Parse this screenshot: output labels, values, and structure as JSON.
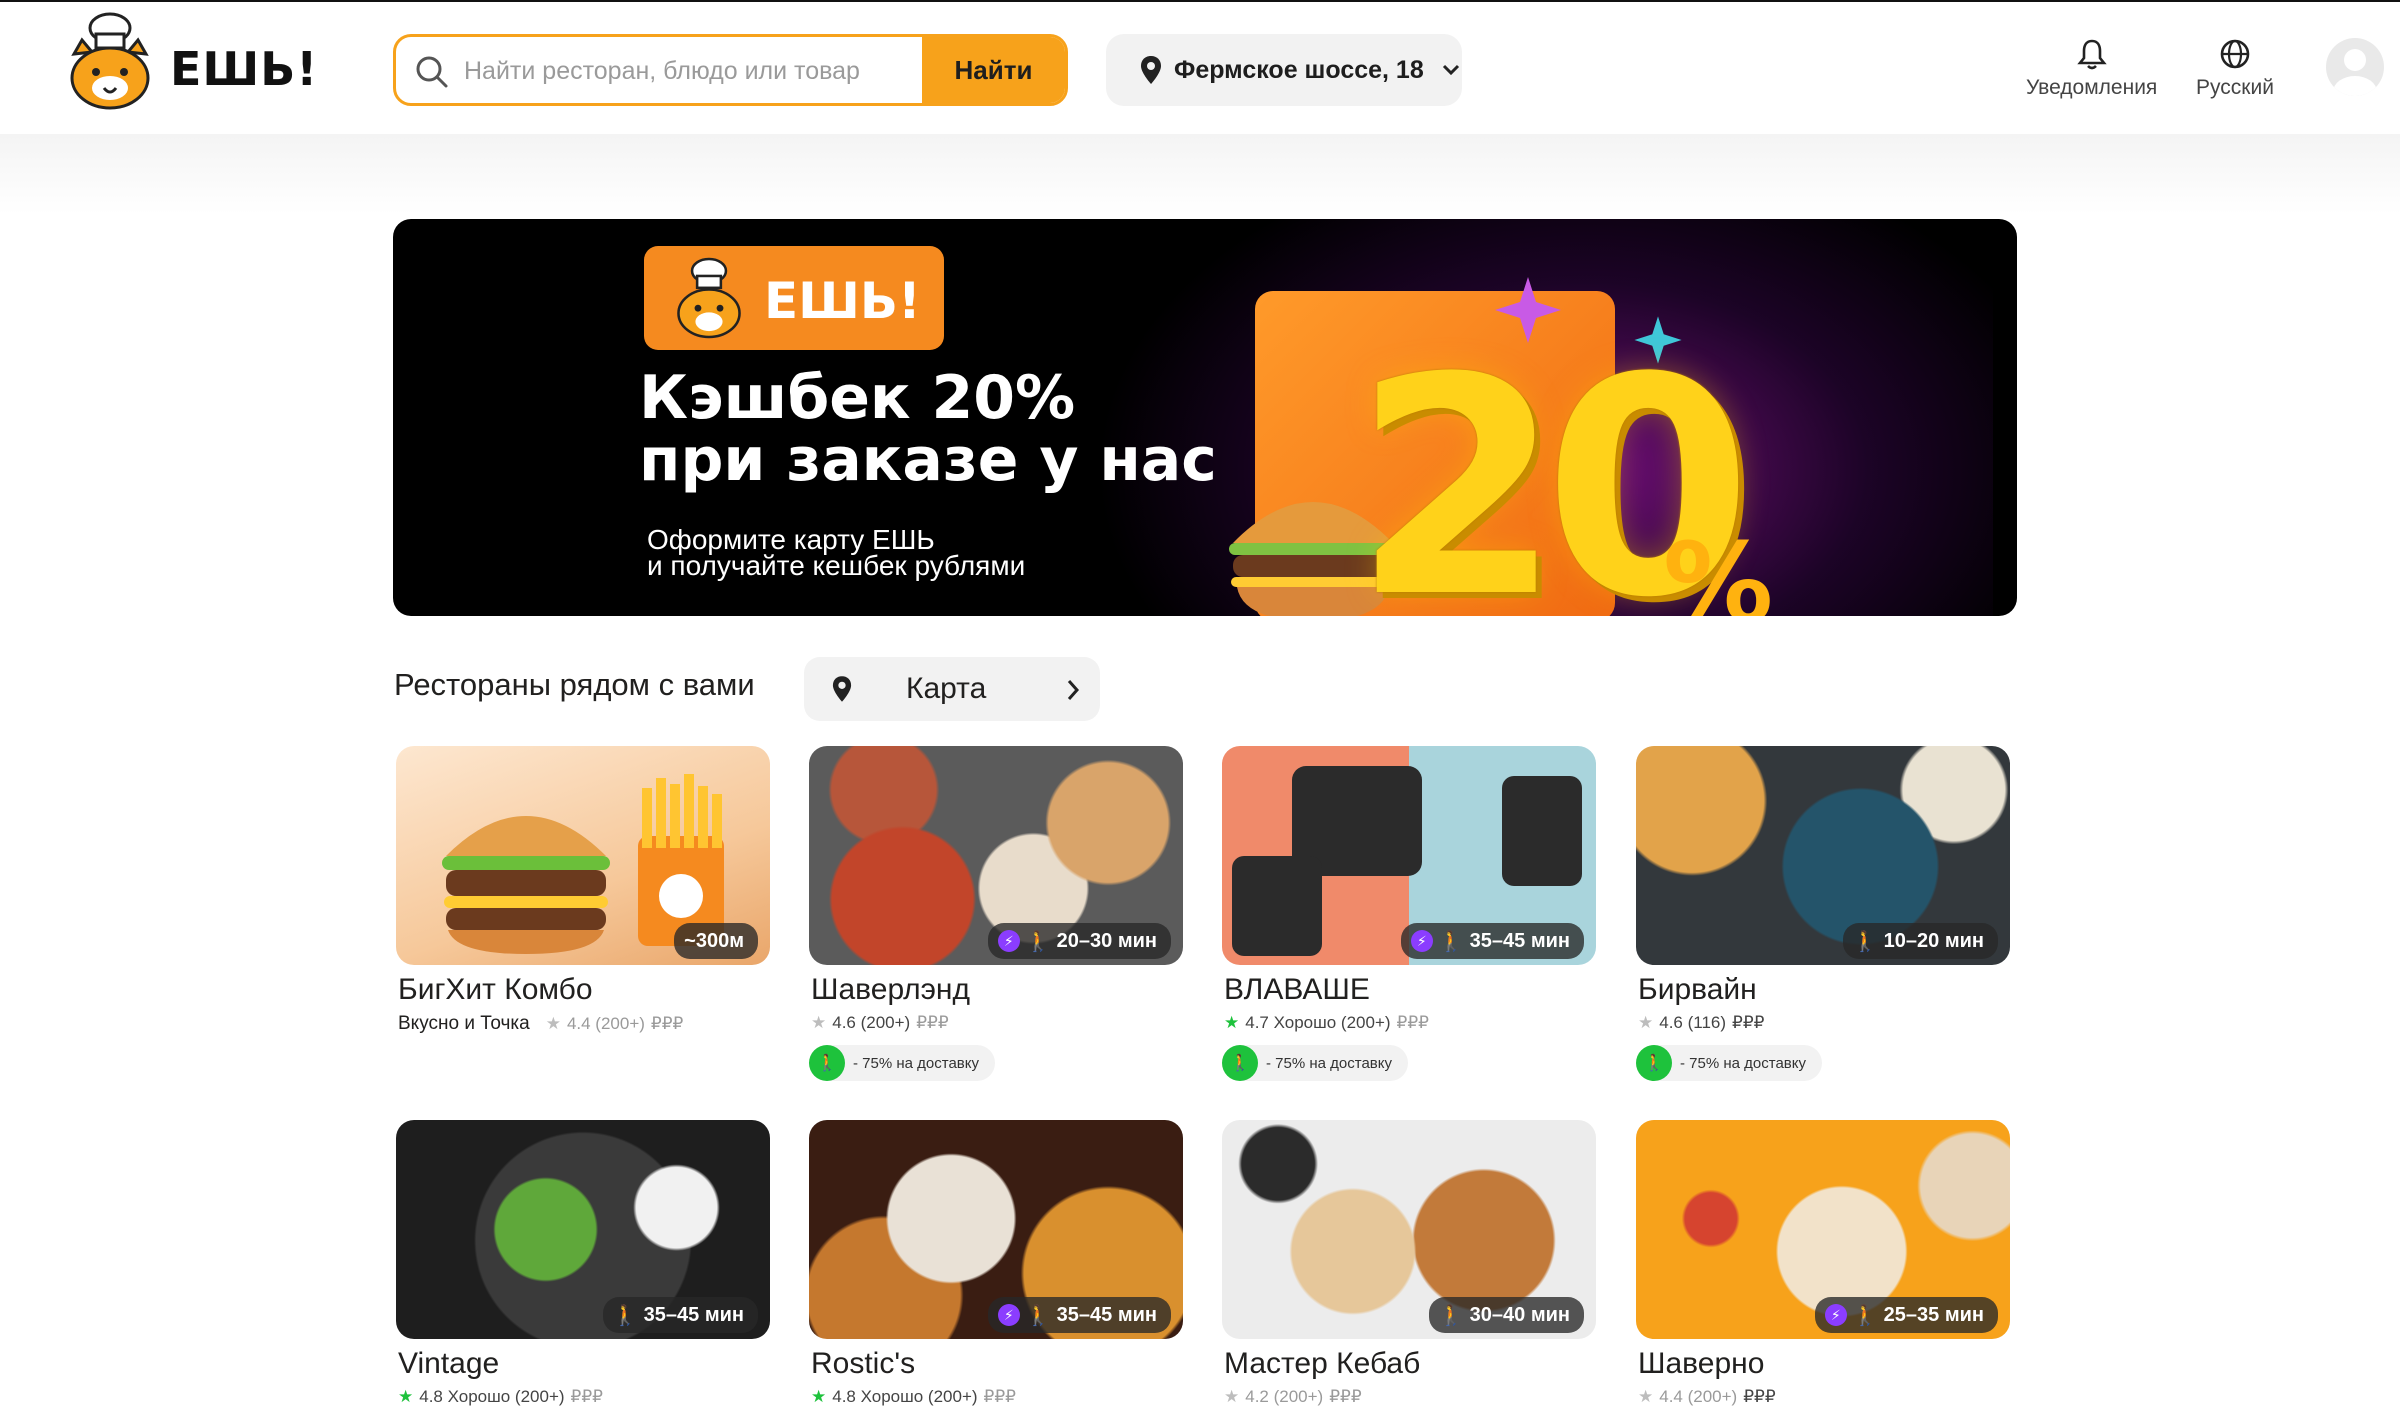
{
  "header": {
    "brand": "ЕШЬ!",
    "search": {
      "placeholder": "Найти ресторан, блюдо или товар",
      "button": "Найти"
    },
    "address": "Фермское шоссе, 18",
    "notifications_label": "Уведомления",
    "language_label": "Русский"
  },
  "banner": {
    "badge": "ЕШЬ!",
    "title_line1": "Кэшбек 20%",
    "title_line2": "при заказе у нас",
    "subtitle_line1": "Оформите карту ЕШЬ",
    "subtitle_line2": "и получайте кешбек рублями",
    "big_number": "20",
    "percent": "%"
  },
  "nearby": {
    "title": "Рестораны рядом с вами",
    "map_button": "Карта"
  },
  "restaurants": [
    {
      "name": "БигХит Комбо",
      "badge": "~300м",
      "tagline": "Вкусно и Точка",
      "rating": "4.4 (200+)",
      "price": "₽₽₽",
      "promo": ""
    },
    {
      "name": "Шаверлэнд",
      "badge": "20–30 мин",
      "tagline": "",
      "rating": "4.6 (200+)",
      "price": "₽₽₽",
      "promo": "- 75% на доставку"
    },
    {
      "name": "ВЛАВАШЕ",
      "badge": "35–45 мин",
      "tagline": "",
      "rating": "4.7 Хорошо (200+)",
      "price": "₽₽₽",
      "promo": "- 75% на доставку"
    },
    {
      "name": "Бирвайн",
      "badge": "10–20 мин",
      "tagline": "",
      "rating": "4.6 (116)",
      "price": "₽₽₽",
      "promo": "- 75% на доставку"
    },
    {
      "name": "Vintage",
      "badge": "35–45 мин",
      "tagline": "",
      "rating": "4.8 Хорошо (200+)",
      "price": "₽₽₽",
      "promo": ""
    },
    {
      "name": "Rostic's",
      "badge": "35–45 мин",
      "tagline": "",
      "rating": "4.8 Хорошо (200+)",
      "price": "₽₽₽",
      "promo": ""
    },
    {
      "name": "Мастер Кебаб",
      "badge": "30–40 мин",
      "tagline": "",
      "rating": "4.2 (200+)",
      "price": "₽₽₽",
      "promo": ""
    },
    {
      "name": "Шаверно",
      "badge": "25–35 мин",
      "tagline": "",
      "rating": "4.4 (200+)",
      "price": "₽₽₽",
      "promo": ""
    }
  ],
  "colors": {
    "accent": "#f7a21b",
    "promo_green": "#1ec23c",
    "rating_green": "#1ec23c",
    "bolt_purple": "#8b3dff"
  }
}
